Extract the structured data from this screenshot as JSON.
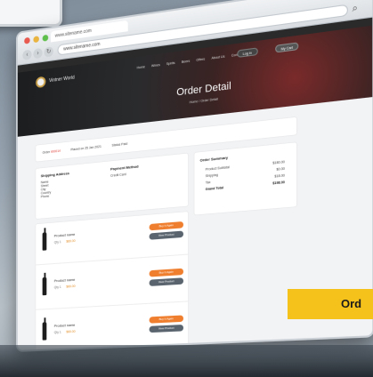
{
  "browser": {
    "tab_title": "www.sitename.com",
    "url": "www.sitename.com"
  },
  "site": {
    "logo_text": "Vintner World",
    "nav": [
      "Home",
      "Wines",
      "Spirits",
      "Beers",
      "Offers",
      "About Us",
      "Contact Us"
    ],
    "login_label": "Log in",
    "cart_label": "My Cart"
  },
  "hero": {
    "title": "Order Detail",
    "breadcrumb": "Home / Order Detail"
  },
  "order": {
    "id_label": "Order",
    "id_value": "#00014",
    "placed_label": "Placed on",
    "placed_value": "25 Jan 2021",
    "status_label": "Status",
    "status_value": "Paid"
  },
  "shipping": {
    "title": "Shipping Address",
    "lines": [
      "Name",
      "Street",
      "City",
      "Country",
      "Phone"
    ]
  },
  "payment": {
    "title": "Payment Method",
    "value": "Credit Card"
  },
  "summary": {
    "title": "Order Summary",
    "rows": [
      {
        "label": "Product Subtotal",
        "value": "$180.00"
      },
      {
        "label": "Shipping",
        "value": "$0.00"
      },
      {
        "label": "Tax",
        "value": "$18.00"
      },
      {
        "label": "Grand Total",
        "value": "$198.00"
      }
    ]
  },
  "items": [
    {
      "name": "Product name",
      "qty": "Qty 1",
      "price": "$60.00",
      "btn1": "Buy It Again",
      "btn2": "View Product"
    },
    {
      "name": "Product name",
      "qty": "Qty 1",
      "price": "$60.00",
      "btn1": "Buy It Again",
      "btn2": "View Product"
    },
    {
      "name": "Product name",
      "qty": "Qty 1",
      "price": "$60.00",
      "btn1": "Buy It Again",
      "btn2": "View Product"
    }
  ],
  "banner": {
    "label": "Ord"
  }
}
